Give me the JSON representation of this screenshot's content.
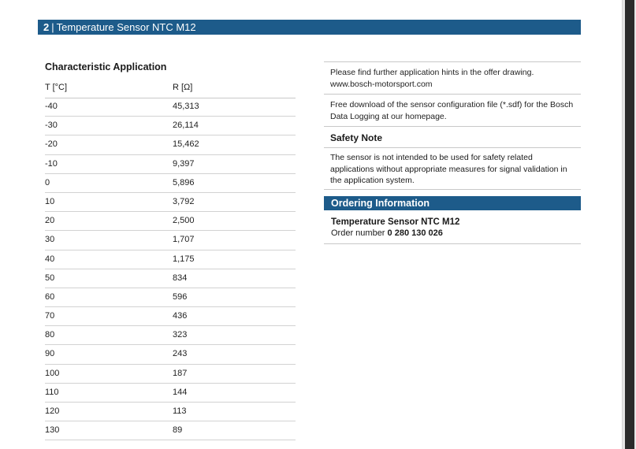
{
  "header": {
    "page_number": "2",
    "separator": "|",
    "title": "Temperature Sensor NTC M12"
  },
  "characteristic": {
    "title": "Characteristic Application",
    "col_temp": "T [°C]",
    "col_res": "R [Ω]",
    "rows": [
      {
        "t": "-40",
        "r": "45,313"
      },
      {
        "t": "-30",
        "r": "26,114"
      },
      {
        "t": "-20",
        "r": "15,462"
      },
      {
        "t": "-10",
        "r": "9,397"
      },
      {
        "t": "0",
        "r": "5,896"
      },
      {
        "t": "10",
        "r": "3,792"
      },
      {
        "t": "20",
        "r": "2,500"
      },
      {
        "t": "30",
        "r": "1,707"
      },
      {
        "t": "40",
        "r": "1,175"
      },
      {
        "t": "50",
        "r": "834"
      },
      {
        "t": "60",
        "r": "596"
      },
      {
        "t": "70",
        "r": "436"
      },
      {
        "t": "80",
        "r": "323"
      },
      {
        "t": "90",
        "r": "243"
      },
      {
        "t": "100",
        "r": "187"
      },
      {
        "t": "110",
        "r": "144"
      },
      {
        "t": "120",
        "r": "113"
      },
      {
        "t": "130",
        "r": "89"
      }
    ]
  },
  "right": {
    "hint_text": "Please find further application hints in the offer drawing. www.bosch-motorsport.com",
    "download_text": "Free download of the sensor configuration file (*.sdf) for the Bosch Data Logging at our homepage.",
    "safety_title": "Safety Note",
    "safety_text": "The sensor is not intended to be used for safety related applications without appropriate measures for signal validation in the application system.",
    "ordering_title": "Ordering Information",
    "product_name": "Temperature Sensor NTC M12",
    "order_label": "Order number",
    "order_number": "0 280 130 026"
  }
}
